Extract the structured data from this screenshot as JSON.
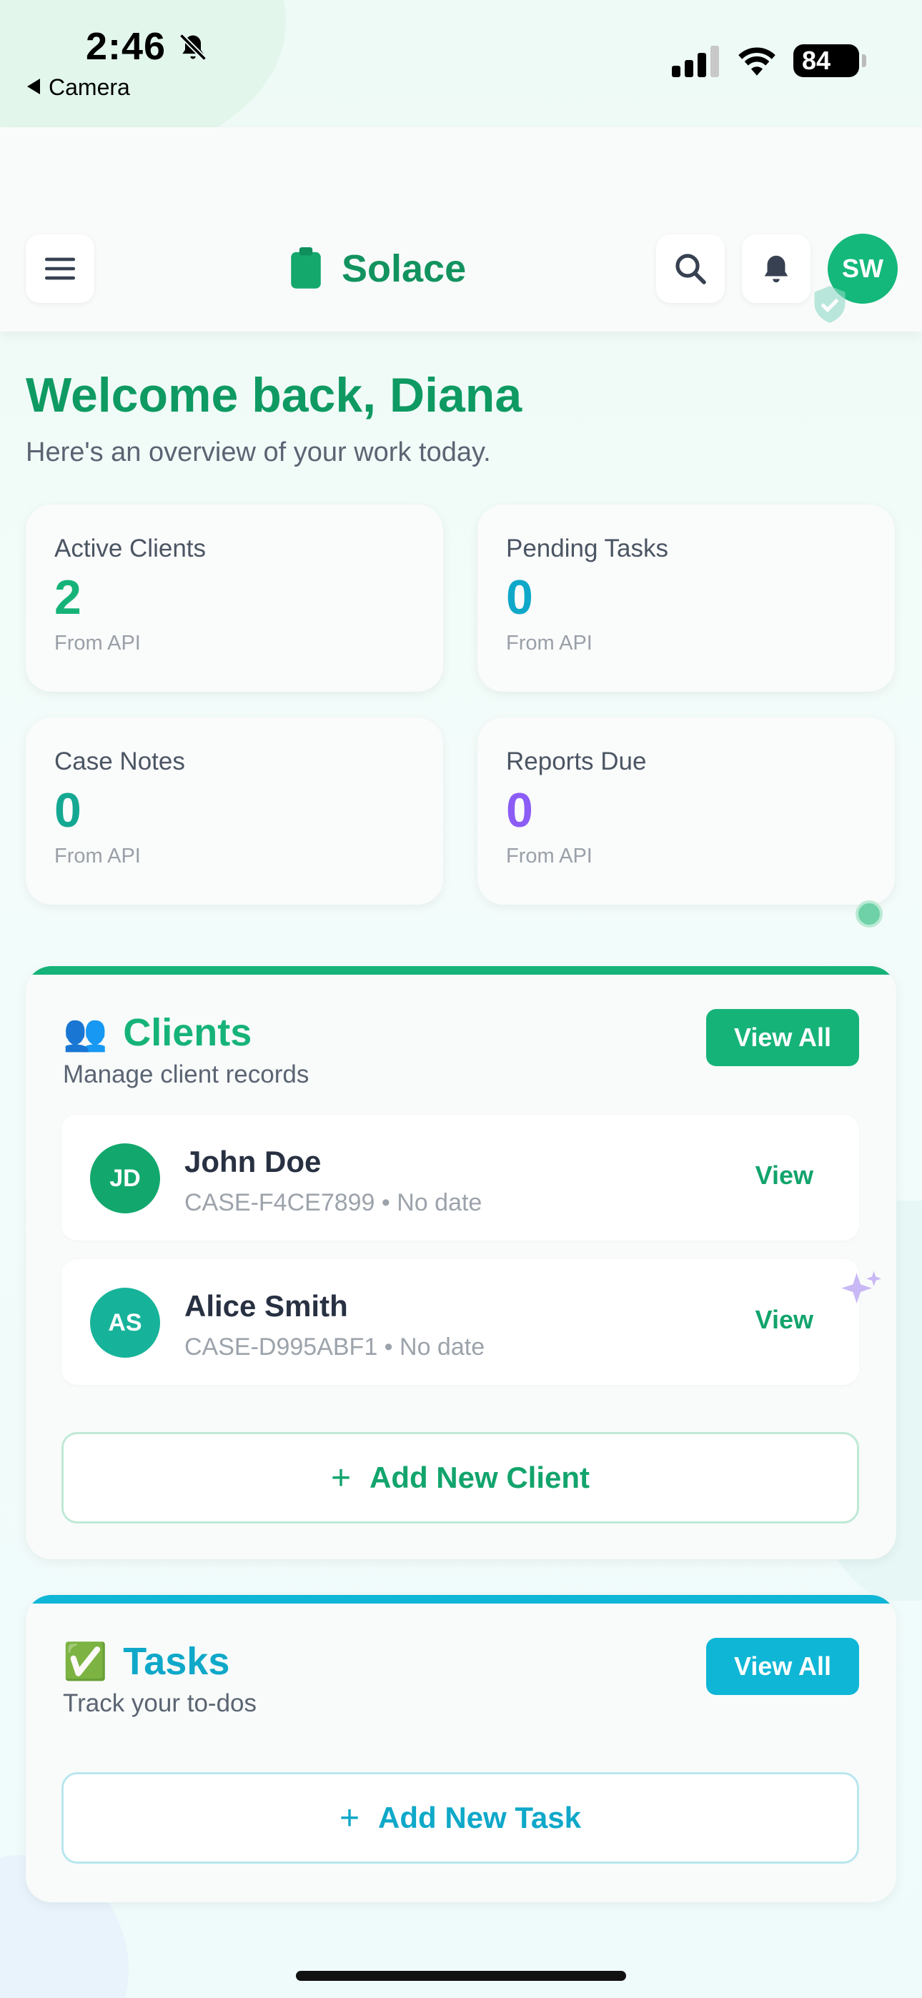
{
  "status_bar": {
    "time": "2:46",
    "back_label": "Camera",
    "battery": "84"
  },
  "header": {
    "app_title": "Solace",
    "avatar_initials": "SW"
  },
  "welcome": {
    "title": "Welcome back, Diana",
    "subtitle": "Here's an overview of your work today."
  },
  "stats": [
    {
      "label": "Active Clients",
      "value": "2",
      "note": "From API",
      "color": "#16b379"
    },
    {
      "label": "Pending Tasks",
      "value": "0",
      "note": "From API",
      "color": "#0fa8c9"
    },
    {
      "label": "Case Notes",
      "value": "0",
      "note": "From API",
      "color": "#14a892"
    },
    {
      "label": "Reports Due",
      "value": "0",
      "note": "From API",
      "color": "#8b5cf6"
    }
  ],
  "clients": {
    "emoji": "👥",
    "title": "Clients",
    "subtitle": "Manage client records",
    "view_all": "View All",
    "accent": "#16b379",
    "items": [
      {
        "initials": "JD",
        "name": "John Doe",
        "meta": "CASE-F4CE7899 • No date",
        "action": "View",
        "avatar_color": "#12a86d"
      },
      {
        "initials": "AS",
        "name": "Alice Smith",
        "meta": "CASE-D995ABF1 • No date",
        "action": "View",
        "avatar_color": "#16b39a"
      }
    ],
    "add_label": "Add New Client"
  },
  "tasks": {
    "emoji": "✅",
    "title": "Tasks",
    "subtitle": "Track your to-dos",
    "view_all": "View All",
    "accent": "#0fb6d6",
    "add_label": "Add New Task"
  }
}
